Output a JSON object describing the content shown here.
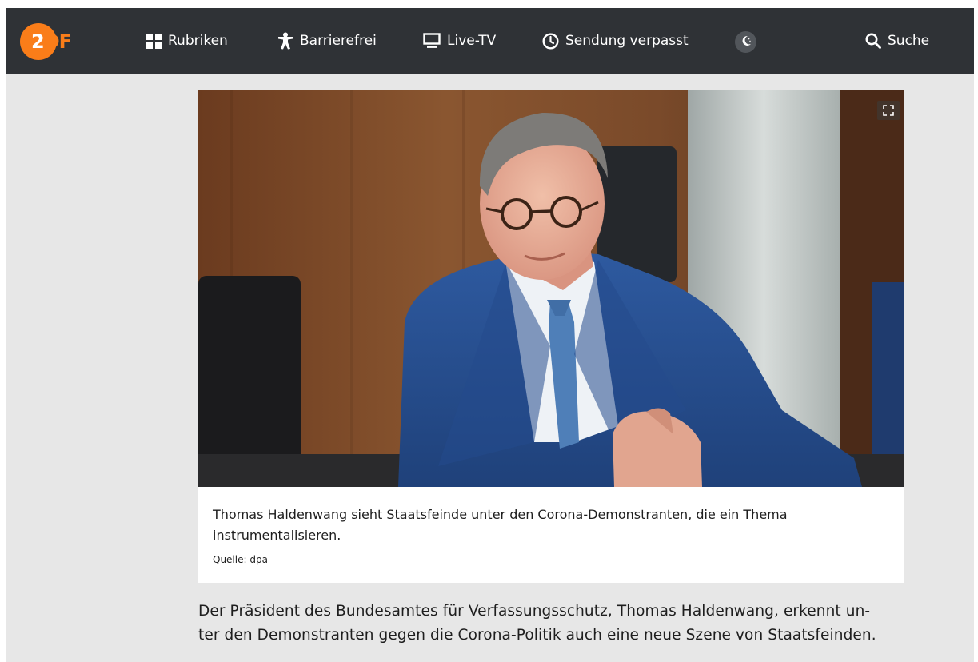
{
  "header": {
    "logo": {
      "primary": "2",
      "secondary": "DF"
    },
    "nav": {
      "rubriken": {
        "label": "Rubriken",
        "icon": "grid-icon"
      },
      "barrierefrei": {
        "label": "Barrierefrei",
        "icon": "accessibility-icon"
      },
      "livetv": {
        "label": "Live-TV",
        "icon": "monitor-icon"
      },
      "verpasst": {
        "label": "Sendung verpasst",
        "icon": "clock-icon"
      },
      "theme": {
        "icon": "moon-icon"
      },
      "suche": {
        "label": "Suche",
        "icon": "search-icon"
      }
    }
  },
  "article": {
    "image": {
      "icon": "fullscreen-icon"
    },
    "caption": "Thomas Haldenwang sieht Staatsfeinde unter den Corona-Demonstranten, die ein Thema instrumentalisieren.",
    "source": "Quelle: dpa",
    "lead_line1": "Der Präsident des Bundesamtes für Verfassungsschutz, Thomas Haldenwang, erkennt un-",
    "lead_line2": "ter den Demonstranten gegen die Corona-Politik auch eine neue Szene von Staatsfeinden."
  },
  "colors": {
    "header_bg": "#2f3236",
    "brand_orange": "#fa7d19",
    "page_bg": "#e7e7e7",
    "text": "#1e1e1e"
  }
}
